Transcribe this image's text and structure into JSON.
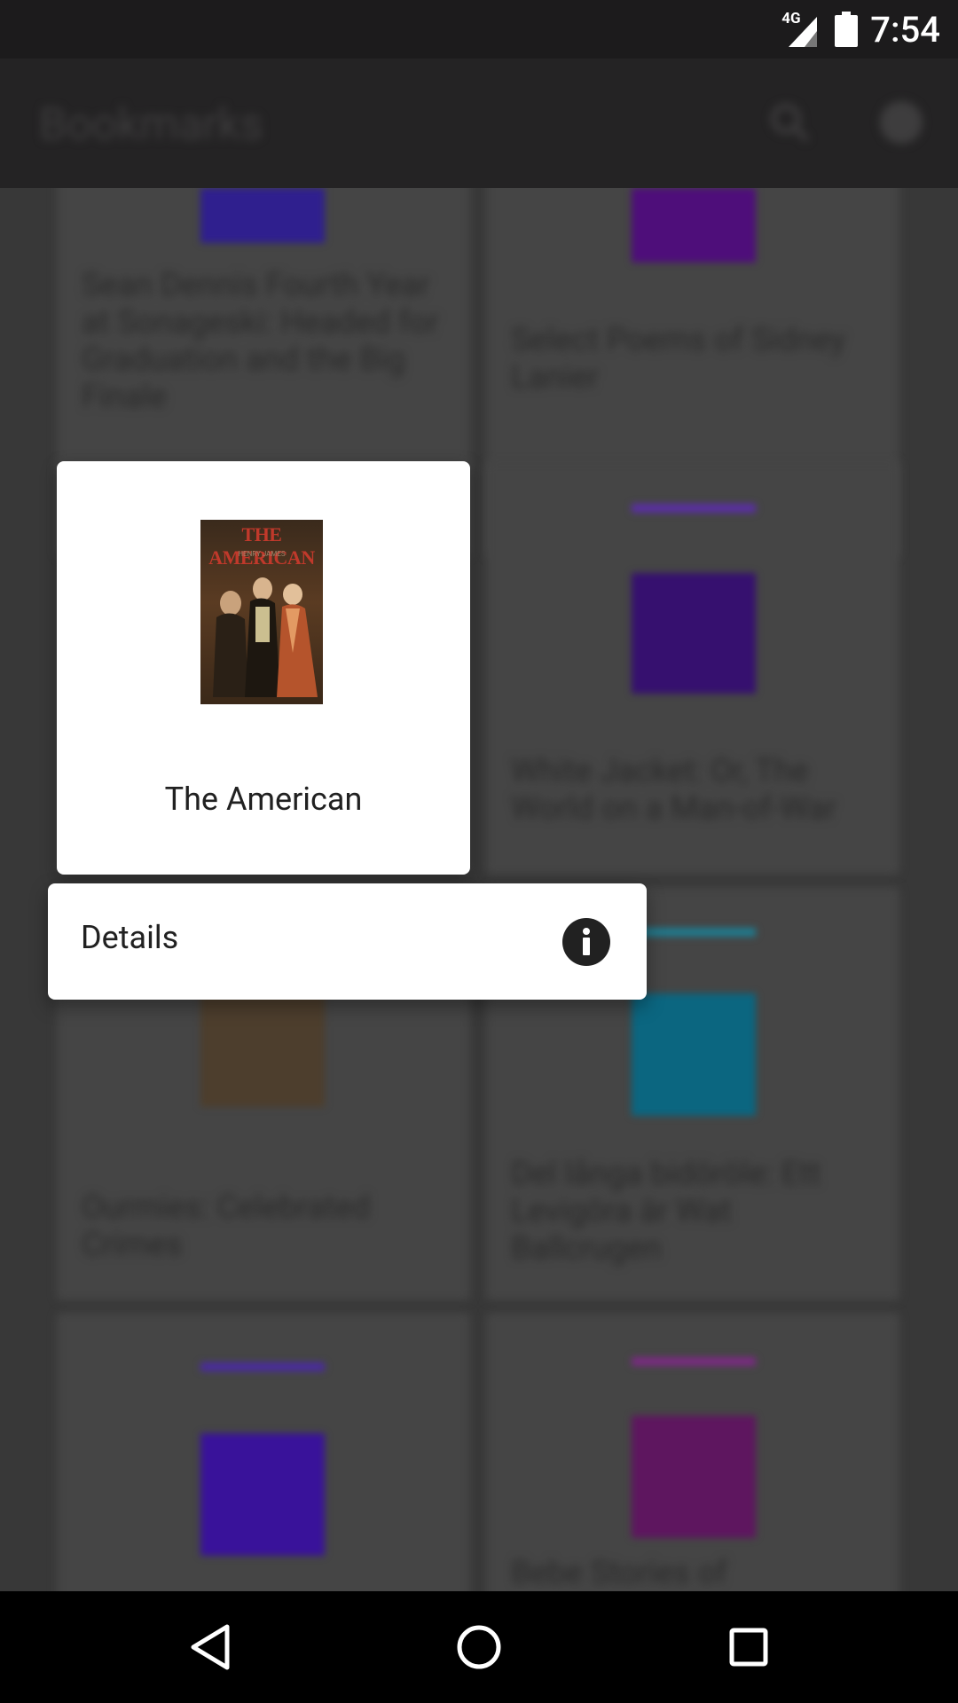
{
  "status_bar": {
    "network": "4G",
    "time": "7:54"
  },
  "app_bar": {
    "title": "Bookmarks"
  },
  "background_grid": {
    "items": [
      {
        "title": "Sean Dennis Fourth Year at Sonageski: Headed for Graduation and the Big Finale",
        "cover_color": "#3c1d9a"
      },
      {
        "title": "Select Poems of Sidney Lanier",
        "cover_color": "#5b0e87"
      },
      {
        "title": "",
        "cover_color": "#3f1d98"
      },
      {
        "title": "White Jacket: Or, The World on a Man-of-War",
        "cover_color": "#3f0f86"
      },
      {
        "title": "Ourmies: Celebrated Crimes",
        "cover_color": "#6e5a3c"
      },
      {
        "title": "Del långa bidöröle: Ett Levigöra är Wat Ballcrugen",
        "cover_color": "#0a6f8c"
      },
      {
        "title": "",
        "cover_color": "#3a1299"
      },
      {
        "title": "Bebe Stories of",
        "cover_color": "#6a1a6f"
      }
    ]
  },
  "selected_book": {
    "title": "The American",
    "cover_title": "THE AMERICAN",
    "cover_author": "HENRY JAMES"
  },
  "popup_menu": {
    "details_label": "Details",
    "details_icon": "info-icon"
  },
  "nav_bar": {
    "back": "back-icon",
    "home": "home-icon",
    "recents": "recents-icon"
  }
}
